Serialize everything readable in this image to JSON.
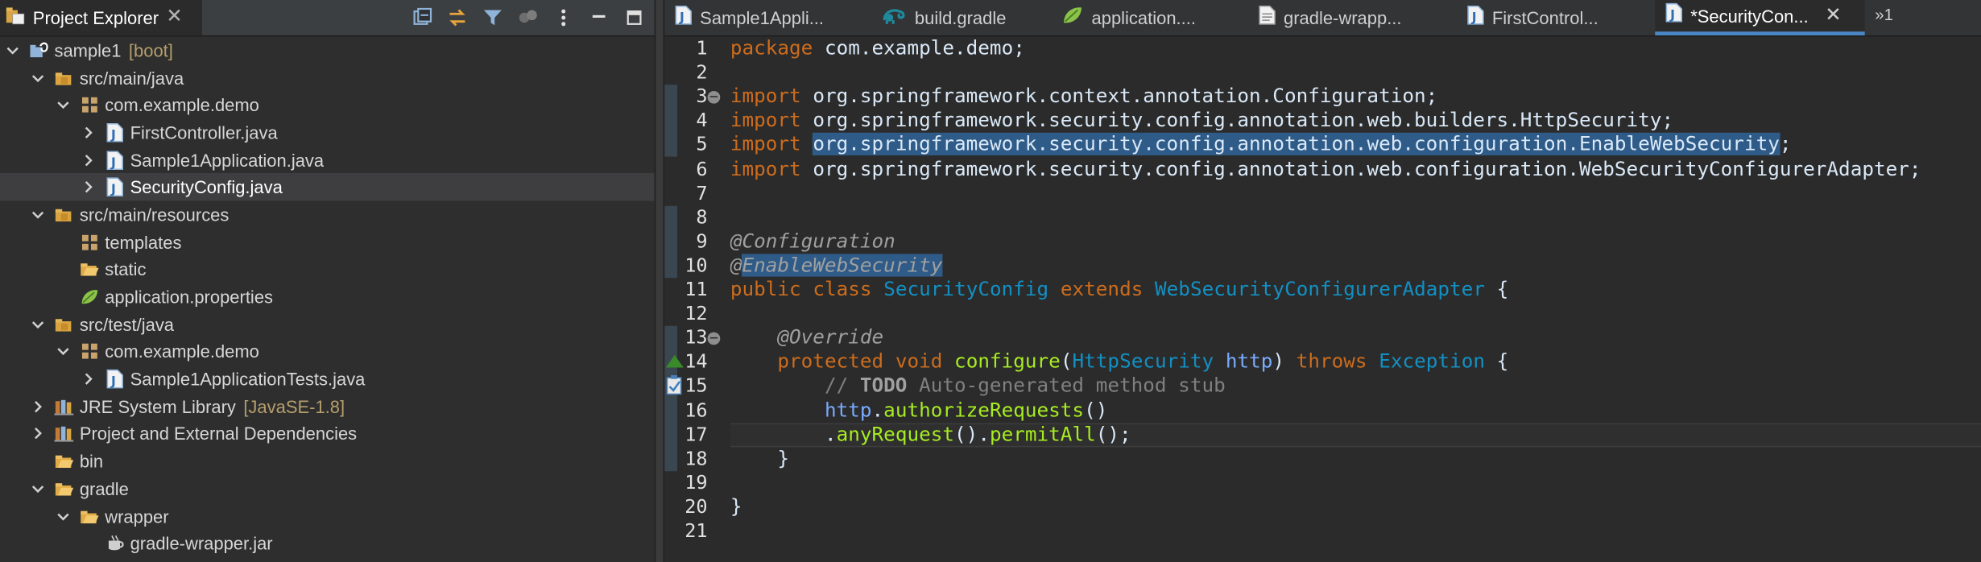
{
  "explorer": {
    "title": "Project Explorer",
    "tree": [
      {
        "label": "sample1",
        "decoration": "[boot]",
        "icon": "project-icon",
        "twisty": "open",
        "depth": 0
      },
      {
        "label": "src/main/java",
        "icon": "source-folder-icon",
        "twisty": "open",
        "depth": 1
      },
      {
        "label": "com.example.demo",
        "icon": "package-icon",
        "twisty": "open",
        "depth": 2
      },
      {
        "label": "FirstController.java",
        "icon": "java-file-icon",
        "twisty": "closed",
        "depth": 3
      },
      {
        "label": "Sample1Application.java",
        "icon": "java-file-icon",
        "twisty": "closed",
        "depth": 3
      },
      {
        "label": "SecurityConfig.java",
        "icon": "java-file-icon",
        "twisty": "closed",
        "depth": 3,
        "selected": true
      },
      {
        "label": "src/main/resources",
        "icon": "source-folder-icon",
        "twisty": "open",
        "depth": 1
      },
      {
        "label": "templates",
        "icon": "package-icon",
        "twisty": "none",
        "depth": 2
      },
      {
        "label": "static",
        "icon": "folder-icon",
        "twisty": "none",
        "depth": 2
      },
      {
        "label": "application.properties",
        "icon": "spring-leaf-icon",
        "twisty": "none",
        "depth": 2
      },
      {
        "label": "src/test/java",
        "icon": "source-folder-icon",
        "twisty": "open",
        "depth": 1
      },
      {
        "label": "com.example.demo",
        "icon": "package-icon",
        "twisty": "open",
        "depth": 2
      },
      {
        "label": "Sample1ApplicationTests.java",
        "icon": "java-file-icon",
        "twisty": "closed",
        "depth": 3
      },
      {
        "label": "JRE System Library",
        "decoration": "[JavaSE-1.8]",
        "icon": "library-icon",
        "twisty": "closed",
        "depth": 1
      },
      {
        "label": "Project and External Dependencies",
        "icon": "library-icon",
        "twisty": "closed",
        "depth": 1
      },
      {
        "label": "bin",
        "icon": "folder-icon",
        "twisty": "none",
        "depth": 1
      },
      {
        "label": "gradle",
        "icon": "folder-icon",
        "twisty": "open",
        "depth": 1
      },
      {
        "label": "wrapper",
        "icon": "folder-icon",
        "twisty": "open",
        "depth": 2
      },
      {
        "label": "gradle-wrapper.jar",
        "icon": "jar-icon",
        "twisty": "none",
        "depth": 3
      }
    ]
  },
  "editor": {
    "tabs": [
      {
        "label": "Sample1Appli...",
        "icon": "java-file-icon"
      },
      {
        "label": "build.gradle",
        "icon": "gradle-elephant-icon"
      },
      {
        "label": "application....",
        "icon": "spring-leaf-icon"
      },
      {
        "label": "gradle-wrapp...",
        "icon": "text-file-icon"
      },
      {
        "label": "FirstControl...",
        "icon": "java-file-icon"
      },
      {
        "label": "*SecurityCon...",
        "icon": "java-file-icon",
        "active": true
      }
    ],
    "overflow_label": "»1",
    "current_line": 17,
    "lines": [
      {
        "n": "1",
        "html": "<span class=\"kw\">package</span> com.example.demo;"
      },
      {
        "n": "2",
        "html": ""
      },
      {
        "n": "3",
        "html": "<span class=\"kw\">import</span> org.springframework.context.annotation.Configuration;",
        "fold": true
      },
      {
        "n": "4",
        "html": "<span class=\"kw\">import</span> org.springframework.security.config.annotation.web.builders.HttpSecurity;"
      },
      {
        "n": "5",
        "html": "<span class=\"kw\">import</span> <span class=\"hl\">org.springframework.security.config.annotation.web.configuration.EnableWebSecurity</span>;"
      },
      {
        "n": "6",
        "html": "<span class=\"kw\">import</span> org.springframework.security.config.annotation.web.configuration.WebSecurityConfigurerAdapter;"
      },
      {
        "n": "7",
        "html": ""
      },
      {
        "n": "8",
        "html": ""
      },
      {
        "n": "9",
        "html": "<span class=\"ann\">@Configuration</span>"
      },
      {
        "n": "10",
        "html": "<span class=\"ann\">@<span class=\"hl\">EnableWebSecurity</span></span>"
      },
      {
        "n": "11",
        "html": "<span class=\"kw\">public</span> <span class=\"kw\">class</span> <span class=\"cls\">SecurityConfig</span> <span class=\"kw\">extends</span> <span class=\"cls\">WebSecurityConfigurerAdapter</span> {"
      },
      {
        "n": "12",
        "html": ""
      },
      {
        "n": "13",
        "html": "    <span class=\"ann\">@Override</span>",
        "fold": true
      },
      {
        "n": "14",
        "html": "    <span class=\"kw\">protected</span> <span class=\"kw\">void</span> <span class=\"mth\">configure</span>(<span class=\"cls\">HttpSecurity</span> <span class=\"var\">http</span>) <span class=\"kw\">throws</span> <span class=\"cls\">Exception</span> {",
        "marker": "override"
      },
      {
        "n": "15",
        "html": "        <span class=\"cmt\">// </span><span class=\"todo\">TODO</span><span class=\"cmt\"> Auto-generated method stub</span>",
        "marker": "task"
      },
      {
        "n": "16",
        "html": "        <span class=\"var\">http</span>.<span class=\"mth\">authorizeRequests</span>()"
      },
      {
        "n": "17",
        "html": "        .<span class=\"mth\">anyRequest</span>().<span class=\"mth\">permitAll</span>();"
      },
      {
        "n": "18",
        "html": "    }"
      },
      {
        "n": "19",
        "html": ""
      },
      {
        "n": "20",
        "html": "}"
      },
      {
        "n": "21",
        "html": ""
      }
    ]
  }
}
